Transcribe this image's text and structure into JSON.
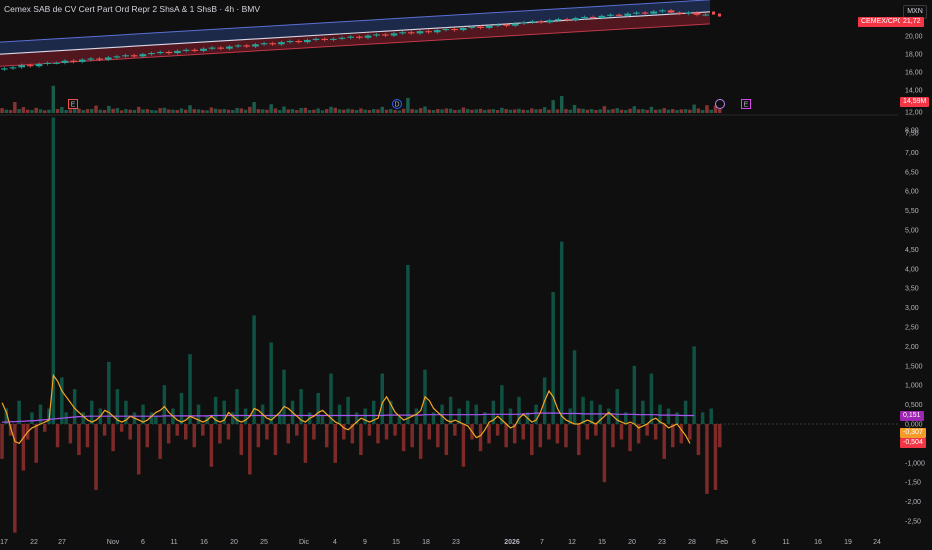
{
  "header": {
    "title": "Cemex SAB de CV Cert Part Ord Repr 2 ShsA & 1 ShsB · 4h · BMV",
    "currency": "MXN"
  },
  "price_pane": {
    "price_tag": "21,72",
    "symbol_tag": "CEMEX/CPO",
    "volume_tag": "14,59M",
    "y_ticks": [
      "20,00",
      "18,00",
      "16,00",
      "14,00"
    ],
    "markers": [
      {
        "type": "E",
        "x_label": "27"
      },
      {
        "type": "D",
        "x_label": "15"
      },
      {
        "type": "split",
        "x_label": "28"
      },
      {
        "type": "E",
        "x_label": "Feb"
      }
    ]
  },
  "indicator_pane": {
    "y_ticks": [
      "12,00",
      "8,00",
      "7,50",
      "7,00",
      "6,50",
      "6,00",
      "5,50",
      "5,00",
      "4,50",
      "4,00",
      "3,50",
      "3,00",
      "2,50",
      "2,00",
      "1,500",
      "1,000",
      "0,500",
      "0,000",
      "-1,000",
      "-1,50",
      "-2,00",
      "-2,50"
    ],
    "tags": [
      {
        "value": "0,151",
        "color": "#9c27b0"
      },
      {
        "value": "-0,307",
        "color": "#f59b28"
      },
      {
        "value": "-0,504",
        "color": "#f23645"
      }
    ]
  },
  "x_axis": {
    "labels": [
      "17",
      "22",
      "27",
      "Nov",
      "6",
      "11",
      "16",
      "20",
      "25",
      "Dic",
      "4",
      "9",
      "15",
      "18",
      "23",
      "2026",
      "7",
      "12",
      "15",
      "20",
      "23",
      "28",
      "Feb",
      "6",
      "11",
      "16",
      "19",
      "24"
    ]
  },
  "chart_data": {
    "type": "bar",
    "title": "Cemex SAB de CV Cert Part Ord Repr 2 ShsA & 1 ShsB · 4h · BMV",
    "ylim": [
      -2.75,
      7.75
    ],
    "price_ylim": [
      13.0,
      22.5
    ],
    "last_price": 21.72,
    "series": [
      {
        "values": [
          -0.9,
          0.4,
          -0.3,
          -2.8,
          0.6,
          -1.2,
          -0.4,
          0.3,
          -1.0,
          0.5,
          -0.2,
          0.4,
          7.9,
          -0.6,
          1.2,
          0.3,
          -0.5,
          0.9,
          -0.8,
          0.3,
          -0.6,
          0.6,
          -1.7,
          0.4,
          -0.3,
          1.6,
          -0.7,
          0.9,
          -0.2,
          0.6,
          -0.4,
          0.3,
          -1.3,
          0.5,
          -0.6,
          0.3,
          0.2,
          -0.9,
          1.0,
          -0.5,
          0.4,
          -0.3,
          0.8,
          -0.4,
          1.8,
          -0.6,
          0.5,
          -0.3,
          0.2,
          -1.1,
          0.7,
          -0.5,
          0.6,
          -0.4,
          0.3,
          0.9,
          -0.8,
          0.4,
          -1.3,
          2.8,
          -0.6,
          0.5,
          -0.4,
          2.1,
          -0.8,
          0.3,
          1.4,
          -0.5,
          0.6,
          -0.3,
          0.9,
          -1.0,
          0.3,
          -0.4,
          0.8,
          0.2,
          -0.6,
          1.3,
          -1.0,
          0.5,
          -0.4,
          0.7,
          -0.5,
          0.3,
          -0.8,
          0.4,
          -0.3,
          0.6,
          -0.5,
          1.3,
          -0.4,
          0.6,
          -0.3,
          0.2,
          -0.7,
          4.1,
          -0.6,
          0.4,
          -0.9,
          1.4,
          -0.4,
          0.3,
          -0.6,
          0.5,
          -0.8,
          0.7,
          -0.3,
          0.4,
          -1.1,
          0.6,
          -0.4,
          0.5,
          -0.7,
          0.3,
          -0.5,
          0.6,
          -0.3,
          1.0,
          -0.6,
          0.4,
          -0.5,
          0.7,
          -0.4,
          0.3,
          -0.8,
          0.5,
          -0.6,
          1.2,
          -0.4,
          3.4,
          -0.5,
          4.7,
          -0.6,
          0.4,
          1.9,
          -0.8,
          0.7,
          -0.4,
          0.6,
          -0.3,
          0.5,
          -1.5,
          0.4,
          -0.6,
          0.9,
          -0.4,
          0.3,
          -0.7,
          1.5,
          -0.5,
          0.6,
          -0.3,
          1.3,
          -0.4,
          0.5,
          -0.9,
          0.4,
          -0.6,
          0.3,
          -0.5,
          0.6,
          -0.4,
          2.0,
          -0.8,
          0.3,
          -1.8,
          0.4,
          -1.7,
          -0.6
        ]
      },
      {
        "values": [
          0.55,
          0.3,
          -0.1,
          -0.45,
          -0.5,
          -0.35,
          -0.2,
          -0.1,
          -0.05,
          0.0,
          0.05,
          0.1,
          1.25,
          1.1,
          0.85,
          0.7,
          0.55,
          0.4,
          0.3,
          0.2,
          0.1,
          0.05,
          0.1,
          0.2,
          0.35,
          0.3,
          0.2,
          0.1,
          0.05,
          0.1,
          0.2,
          0.15,
          0.1,
          0.05,
          0.1,
          0.2,
          0.3,
          0.35,
          0.45,
          0.3,
          0.2,
          0.1,
          0.05,
          0.1,
          0.2,
          0.15,
          0.1,
          0.05,
          0.1,
          0.2,
          0.1,
          0.05,
          0.1,
          0.3,
          0.2,
          0.1,
          0.05,
          0.1,
          0.2,
          0.4,
          0.35,
          0.25,
          0.15,
          0.1,
          0.2,
          0.3,
          0.45,
          0.4,
          0.3,
          0.2,
          0.1,
          0.05,
          0.15,
          0.2,
          0.3,
          0.35,
          0.25,
          0.15,
          0.05,
          0.0,
          -0.1,
          -0.15,
          -0.05,
          0.05,
          0.15,
          0.1,
          0.05,
          0.1,
          0.15,
          0.55,
          0.7,
          0.5,
          0.3,
          0.2,
          0.1,
          0.15,
          0.2,
          0.25,
          0.35,
          0.7,
          0.6,
          0.4,
          0.3,
          0.2,
          0.1,
          0.05,
          0.1,
          0.05,
          0.0,
          -0.05,
          -0.2,
          -0.35,
          -0.3,
          -0.15,
          0.05,
          0.1,
          0.2,
          0.1,
          0.0,
          -0.1,
          -0.05,
          0.15,
          0.25,
          0.15,
          0.05,
          0.1,
          0.3,
          0.6,
          0.85,
          0.7,
          0.4,
          0.2,
          0.1,
          0.05,
          0.0,
          0.0,
          0.05,
          0.1,
          0.05,
          0.0,
          0.1,
          0.2,
          0.3,
          0.2,
          0.1,
          0.05,
          0.0,
          0.05,
          0.0,
          -0.1,
          -0.05,
          0.0,
          0.1,
          0.15,
          0.05,
          0.0,
          -0.1,
          -0.05,
          0.0,
          -0.15,
          -0.3,
          -0.5
        ]
      },
      {
        "values": [
          0.05,
          0.05,
          0.06,
          0.06,
          0.07,
          0.07,
          0.08,
          0.08,
          0.09,
          0.1,
          0.11,
          0.12,
          0.13,
          0.14,
          0.15,
          0.16,
          0.17,
          0.18,
          0.19,
          0.19,
          0.2,
          0.2,
          0.2,
          0.2,
          0.2,
          0.2,
          0.2,
          0.2,
          0.2,
          0.2,
          0.2,
          0.2,
          0.2,
          0.2,
          0.2,
          0.2,
          0.2,
          0.2,
          0.21,
          0.21,
          0.21,
          0.21,
          0.21,
          0.21,
          0.21,
          0.21,
          0.21,
          0.21,
          0.21,
          0.22,
          0.22,
          0.22,
          0.22,
          0.22,
          0.22,
          0.22,
          0.22,
          0.22,
          0.22,
          0.22,
          0.22,
          0.22,
          0.22,
          0.22,
          0.22,
          0.22,
          0.22,
          0.22,
          0.22,
          0.22,
          0.22,
          0.22,
          0.22,
          0.22,
          0.22,
          0.22,
          0.22,
          0.22,
          0.22,
          0.22,
          0.22,
          0.22,
          0.22,
          0.22,
          0.22,
          0.22,
          0.22,
          0.22,
          0.22,
          0.22,
          0.23,
          0.23,
          0.23,
          0.23,
          0.23,
          0.23,
          0.23,
          0.23,
          0.23,
          0.24,
          0.24,
          0.24,
          0.24,
          0.24,
          0.24,
          0.24,
          0.24,
          0.24,
          0.24,
          0.24,
          0.24,
          0.24,
          0.24,
          0.25,
          0.25,
          0.25,
          0.25,
          0.25,
          0.25,
          0.25,
          0.25,
          0.25,
          0.26,
          0.26,
          0.27,
          0.28,
          0.28,
          0.28,
          0.28,
          0.28,
          0.28,
          0.27,
          0.27,
          0.27,
          0.27,
          0.27,
          0.26,
          0.26,
          0.26,
          0.26,
          0.26,
          0.26,
          0.26,
          0.26,
          0.25,
          0.25,
          0.25,
          0.25,
          0.25,
          0.24,
          0.24,
          0.24,
          0.24,
          0.24,
          0.23,
          0.23,
          0.23,
          0.23,
          0.23,
          0.22,
          0.22,
          0.22,
          0.22
        ]
      }
    ],
    "price_series": [
      16.8,
      16.9,
      17.1,
      17.0,
      17.2,
      17.3,
      17.3,
      17.5,
      17.4,
      17.6,
      17.7,
      17.6,
      17.8,
      17.9,
      18.0,
      17.9,
      18.1,
      18.2,
      18.3,
      18.2,
      18.4,
      18.5,
      18.4,
      18.6,
      18.7,
      18.6,
      18.8,
      18.9,
      18.8,
      19.0,
      19.1,
      19.0,
      19.2,
      19.3,
      19.2,
      19.4,
      19.5,
      19.4,
      19.5,
      19.6,
      19.7,
      19.6,
      19.8,
      19.9,
      19.8,
      20.0,
      20.1,
      20.0,
      20.2,
      20.1,
      20.3,
      20.4,
      20.3,
      20.5,
      20.6,
      20.5,
      20.7,
      20.8,
      20.7,
      20.9,
      21.0,
      21.1,
      21.0,
      21.2,
      21.3,
      21.2,
      21.4,
      21.5,
      21.4,
      21.6,
      21.7,
      21.6,
      21.8,
      21.9,
      21.8,
      22.0,
      22.1,
      21.9,
      21.8,
      21.9,
      21.7,
      21.72
    ]
  }
}
